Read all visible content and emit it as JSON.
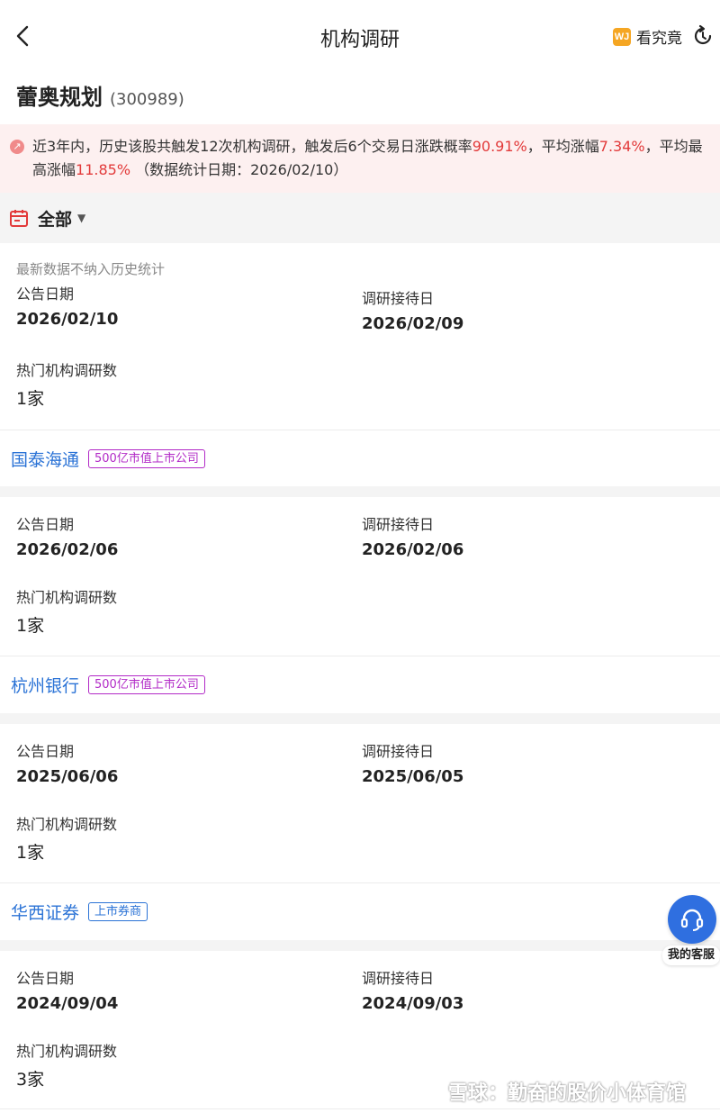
{
  "header": {
    "title": "机构调研",
    "kanjiujing_logo": "WJ",
    "kanjiujing_label": "看究竟"
  },
  "stock": {
    "name": "蕾奥规划",
    "code": "(300989)"
  },
  "stats": {
    "text_1": "近3年内，历史该股共触发12次机构调研，触发后6个交易日涨跌概率",
    "rise_prob": "90.91%",
    "text_2": "，平均涨幅",
    "avg_rise": "7.34%",
    "text_3": "，平均最高涨幅",
    "avg_max_rise": "11.85%",
    "text_4": "（数据统计日期：2026/02/10）"
  },
  "filter": {
    "label": "全部"
  },
  "records": [
    {
      "note": "最新数据不纳入历史统计",
      "announce_label": "公告日期",
      "announce_date": "2026/02/10",
      "reception_label": "调研接待日",
      "reception_date": "2026/02/09",
      "count_label": "热门机构调研数",
      "count": "1家",
      "institution": "国泰海通",
      "tag": "500亿市值上市公司"
    },
    {
      "announce_label": "公告日期",
      "announce_date": "2026/02/06",
      "reception_label": "调研接待日",
      "reception_date": "2026/02/06",
      "count_label": "热门机构调研数",
      "count": "1家",
      "institution": "杭州银行",
      "tag": "500亿市值上市公司"
    },
    {
      "announce_label": "公告日期",
      "announce_date": "2025/06/06",
      "reception_label": "调研接待日",
      "reception_date": "2025/06/05",
      "count_label": "热门机构调研数",
      "count": "1家",
      "institution": "华西证券",
      "tag": "上市券商"
    },
    {
      "announce_label": "公告日期",
      "announce_date": "2024/09/04",
      "reception_label": "调研接待日",
      "reception_date": "2024/09/03",
      "count_label": "热门机构调研数",
      "count": "3家"
    }
  ],
  "customer_service": {
    "label": "我的客服"
  },
  "watermark": {
    "text": "雪球：勤奋的股价小体育馆"
  },
  "colors": {
    "accent_red": "#e23a3a",
    "link_blue": "#2b73d6",
    "tag_purple": "#b22ac7",
    "banner_bg": "#fdf0f0",
    "cs_blue": "#2f6fe0"
  }
}
